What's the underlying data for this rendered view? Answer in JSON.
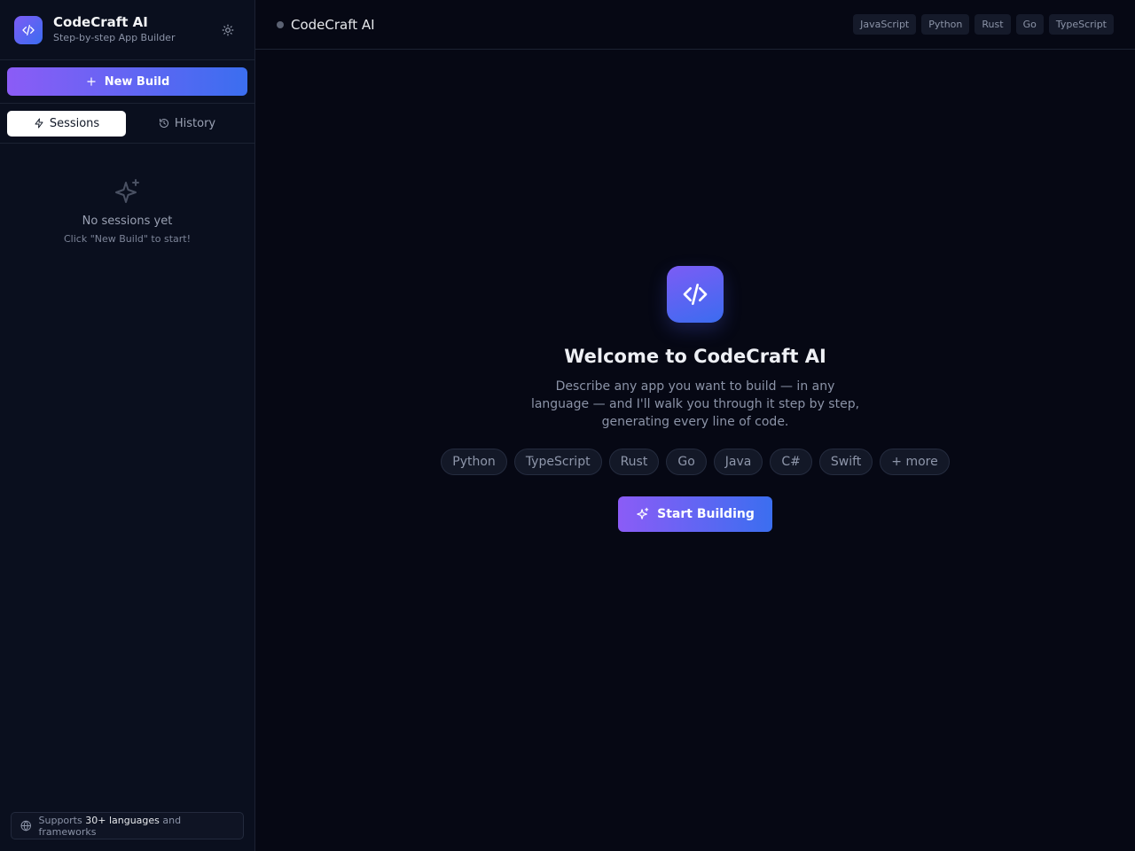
{
  "brand": {
    "title": "CodeCraft AI",
    "subtitle": "Step-by-step App Builder",
    "logo_icon": "code-icon",
    "theme_icon": "sun-icon"
  },
  "sidebar": {
    "new_build_label": "New Build",
    "tabs": [
      {
        "label": "Sessions",
        "icon": "bolt-icon",
        "active": true
      },
      {
        "label": "History",
        "icon": "history-icon",
        "active": false
      }
    ],
    "empty": {
      "title": "No sessions yet",
      "subtitle": "Click \"New Build\" to start!"
    },
    "footer": {
      "prefix": "Supports",
      "highlight": "30+ languages",
      "suffix": "and frameworks"
    }
  },
  "topbar": {
    "title": "CodeCraft AI",
    "languages": [
      "JavaScript",
      "Python",
      "Rust",
      "Go",
      "TypeScript"
    ]
  },
  "welcome": {
    "title": "Welcome to CodeCraft AI",
    "description": "Describe any app you want to build — in any language — and I'll walk you through it step by step, generating every line of code.",
    "chips": [
      "Python",
      "TypeScript",
      "Rust",
      "Go",
      "Java",
      "C#",
      "Swift",
      "+ more"
    ],
    "start_label": "Start Building"
  },
  "colors": {
    "accent_start": "#8b5cf6",
    "accent_end": "#3b6ef0",
    "background": "#060814"
  }
}
